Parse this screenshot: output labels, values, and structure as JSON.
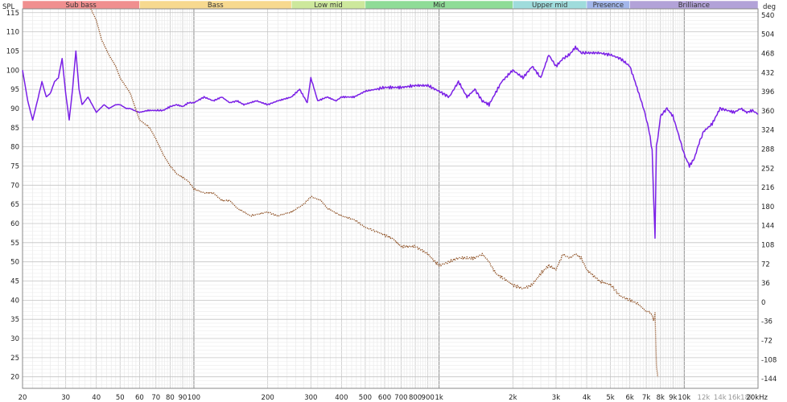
{
  "chart_data": {
    "type": "line",
    "left_axis_label": "SPL",
    "right_axis_label": "deg",
    "x_scale": "log",
    "xlim": [
      20,
      20000
    ],
    "ylim_left": [
      17,
      116
    ],
    "ylim_right": [
      -162,
      552
    ],
    "grid": true,
    "y_ticks_left": [
      20,
      25,
      30,
      35,
      40,
      45,
      50,
      55,
      60,
      65,
      70,
      75,
      80,
      85,
      90,
      95,
      100,
      105,
      110,
      115
    ],
    "y_ticks_right": [
      -144,
      -108,
      -72,
      -36,
      0,
      36,
      72,
      108,
      144,
      180,
      216,
      252,
      288,
      324,
      360,
      396,
      432,
      468,
      504,
      540
    ],
    "x_tick_labels": [
      {
        "v": 20,
        "t": "20",
        "minor": false
      },
      {
        "v": 30,
        "t": "30",
        "minor": false
      },
      {
        "v": 40,
        "t": "40",
        "minor": false
      },
      {
        "v": 50,
        "t": "50",
        "minor": false
      },
      {
        "v": 60,
        "t": "60",
        "minor": false
      },
      {
        "v": 70,
        "t": "70",
        "minor": false
      },
      {
        "v": 80,
        "t": "80",
        "minor": false
      },
      {
        "v": 90,
        "t": "90",
        "minor": false
      },
      {
        "v": 100,
        "t": "100",
        "minor": false
      },
      {
        "v": 200,
        "t": "200",
        "minor": false
      },
      {
        "v": 300,
        "t": "300",
        "minor": false
      },
      {
        "v": 400,
        "t": "400",
        "minor": false
      },
      {
        "v": 500,
        "t": "500",
        "minor": false
      },
      {
        "v": 600,
        "t": "600",
        "minor": false
      },
      {
        "v": 700,
        "t": "700",
        "minor": false
      },
      {
        "v": 800,
        "t": "800",
        "minor": false
      },
      {
        "v": 900,
        "t": "900",
        "minor": false
      },
      {
        "v": 1000,
        "t": "1k",
        "minor": false
      },
      {
        "v": 2000,
        "t": "2k",
        "minor": false
      },
      {
        "v": 3000,
        "t": "3k",
        "minor": false
      },
      {
        "v": 4000,
        "t": "4k",
        "minor": false
      },
      {
        "v": 5000,
        "t": "5k",
        "minor": false
      },
      {
        "v": 6000,
        "t": "6k",
        "minor": false
      },
      {
        "v": 7000,
        "t": "7k",
        "minor": false
      },
      {
        "v": 8000,
        "t": "8k",
        "minor": false
      },
      {
        "v": 9000,
        "t": "9k",
        "minor": false
      },
      {
        "v": 10000,
        "t": "10k",
        "minor": false
      },
      {
        "v": 12000,
        "t": "12k",
        "minor": true
      },
      {
        "v": 14000,
        "t": "14k",
        "minor": true
      },
      {
        "v": 16000,
        "t": "16k",
        "minor": true
      },
      {
        "v": 18000,
        "t": "18k",
        "minor": true
      },
      {
        "v": 20000,
        "t": "20kHz",
        "minor": false
      }
    ],
    "bands": [
      {
        "name": "Sub bass",
        "from": 20,
        "to": 60,
        "color": "#f08f8f"
      },
      {
        "name": "Bass",
        "from": 60,
        "to": 250,
        "color": "#f7d98f"
      },
      {
        "name": "Low mid",
        "from": 250,
        "to": 500,
        "color": "#cde89c"
      },
      {
        "name": "Mid",
        "from": 500,
        "to": 2000,
        "color": "#8fdc97"
      },
      {
        "name": "Upper mid",
        "from": 2000,
        "to": 4000,
        "color": "#9fdcdc"
      },
      {
        "name": "Presence",
        "from": 4000,
        "to": 6000,
        "color": "#a2b6ea"
      },
      {
        "name": "Brilliance",
        "from": 6000,
        "to": 20000,
        "color": "#b2a2d8"
      }
    ],
    "series": [
      {
        "axis": "left",
        "color": "#7a1fe6",
        "style": "solid",
        "x": [
          20,
          21,
          22,
          23,
          24,
          25,
          26,
          27,
          28,
          29,
          30,
          31,
          32,
          33,
          34,
          35,
          37,
          40,
          43,
          45,
          48,
          50,
          53,
          55,
          57,
          60,
          65,
          70,
          75,
          80,
          85,
          90,
          95,
          100,
          110,
          120,
          130,
          140,
          150,
          160,
          180,
          200,
          220,
          250,
          270,
          290,
          300,
          320,
          350,
          380,
          400,
          450,
          500,
          550,
          600,
          700,
          800,
          900,
          1000,
          1100,
          1200,
          1300,
          1400,
          1500,
          1600,
          1800,
          2000,
          2200,
          2400,
          2600,
          2800,
          3000,
          3200,
          3400,
          3600,
          3800,
          4000,
          4500,
          5000,
          5500,
          6000,
          6300,
          6600,
          6900,
          7200,
          7400,
          7500,
          7600,
          7700,
          7800,
          8000,
          8500,
          9000,
          9500,
          10000,
          10500,
          11000,
          11500,
          12000,
          13000,
          14000,
          15000,
          16000,
          17000,
          18000,
          19000,
          20000
        ],
        "y": [
          100,
          92,
          87,
          92,
          97,
          93,
          94,
          97,
          98,
          103,
          94,
          87,
          95,
          105,
          95,
          91,
          93,
          89,
          91,
          90,
          91,
          91,
          90,
          90,
          89.5,
          89,
          89.5,
          89.5,
          89.5,
          90.5,
          91,
          90.5,
          91.5,
          91.5,
          93,
          92,
          93,
          91.5,
          92,
          91,
          92,
          91,
          92,
          93,
          95,
          91.5,
          98,
          92,
          93,
          92,
          93,
          93,
          94.5,
          95,
          95.5,
          95.5,
          96,
          96,
          94.5,
          93,
          97,
          93,
          95,
          92,
          91,
          97,
          100,
          98,
          101,
          98,
          104,
          101,
          103,
          104,
          106,
          104.5,
          104.5,
          104.5,
          104,
          103,
          101,
          97,
          93,
          89,
          84,
          79,
          67,
          56,
          80,
          82,
          88,
          90,
          88,
          83,
          78,
          75,
          77,
          81,
          84,
          86,
          90,
          89.5,
          89,
          90,
          89,
          89.5,
          88.5
        ]
      },
      {
        "axis": "left",
        "color": "#8a4a1c",
        "style": "dotted",
        "x": [
          38,
          40,
          42,
          45,
          48,
          50,
          55,
          60,
          63,
          66,
          70,
          75,
          80,
          85,
          90,
          95,
          100,
          110,
          120,
          130,
          140,
          150,
          170,
          200,
          220,
          250,
          280,
          300,
          330,
          350,
          400,
          450,
          500,
          550,
          600,
          650,
          700,
          800,
          900,
          1000,
          1100,
          1200,
          1300,
          1400,
          1500,
          1600,
          1700,
          1800,
          2000,
          2200,
          2400,
          2600,
          2800,
          3000,
          3200,
          3400,
          3600,
          3800,
          4000,
          4500,
          5000,
          5500,
          6000,
          6500,
          7000,
          7200,
          7400,
          7500,
          7600,
          7700,
          7800
        ],
        "y": [
          116,
          113,
          108,
          104,
          101,
          98,
          94,
          87,
          86,
          85,
          82,
          78,
          75,
          73,
          72,
          71,
          69,
          68,
          68,
          66,
          66,
          64,
          62,
          63,
          62,
          63,
          65,
          67,
          66,
          64,
          62,
          61,
          59,
          58,
          57,
          56,
          54,
          54,
          52,
          49,
          50,
          51,
          51,
          51,
          52,
          50,
          47,
          46,
          44,
          43,
          44,
          47,
          49,
          48,
          52,
          51,
          52,
          51,
          48,
          45,
          44,
          41,
          40,
          39,
          37,
          37,
          36,
          35,
          37,
          23,
          20
        ]
      }
    ]
  }
}
